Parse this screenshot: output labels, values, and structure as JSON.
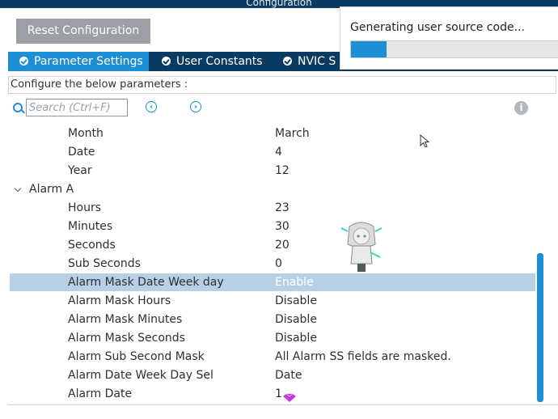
{
  "window": {
    "title": "Configuration"
  },
  "toolbar": {
    "reset_label": "Reset Configuration"
  },
  "tabs": [
    {
      "label": "Parameter Settings",
      "active": true
    },
    {
      "label": "User Constants",
      "active": false
    },
    {
      "label": "NVIC S",
      "active": false
    }
  ],
  "config_bar": {
    "text": "Configure the below parameters :"
  },
  "search": {
    "placeholder": "Search (Ctrl+F)"
  },
  "params": {
    "month": {
      "name": "Month",
      "value": "March"
    },
    "date": {
      "name": "Date",
      "value": "4"
    },
    "year": {
      "name": "Year",
      "value": "12"
    },
    "alarm_a": {
      "name": "Alarm A"
    },
    "hours": {
      "name": "Hours",
      "value": "23"
    },
    "minutes": {
      "name": "Minutes",
      "value": "30"
    },
    "seconds": {
      "name": "Seconds",
      "value": "20"
    },
    "sub_seconds": {
      "name": "Sub Seconds",
      "value": "0"
    },
    "mask_date_week_day": {
      "name": "Alarm Mask Date Week day",
      "value": "Enable"
    },
    "mask_hours": {
      "name": "Alarm Mask Hours",
      "value": "Disable"
    },
    "mask_minutes": {
      "name": "Alarm Mask Minutes",
      "value": "Disable"
    },
    "mask_seconds": {
      "name": "Alarm Mask Seconds",
      "value": "Disable"
    },
    "sub_second_mask": {
      "name": "Alarm Sub Second Mask",
      "value": "All Alarm SS fields are masked."
    },
    "date_week_day_sel": {
      "name": "Alarm Date Week Day Sel",
      "value": "Date"
    },
    "alarm_date": {
      "name": "Alarm Date",
      "value": "1"
    }
  },
  "progress_dialog": {
    "label": "Generating user source code...",
    "progress": 0.17
  },
  "colors": {
    "accent": "#1e8fd7",
    "header": "#0b3b60",
    "selection": "#b7d0e6",
    "button": "#9aa0a6"
  }
}
